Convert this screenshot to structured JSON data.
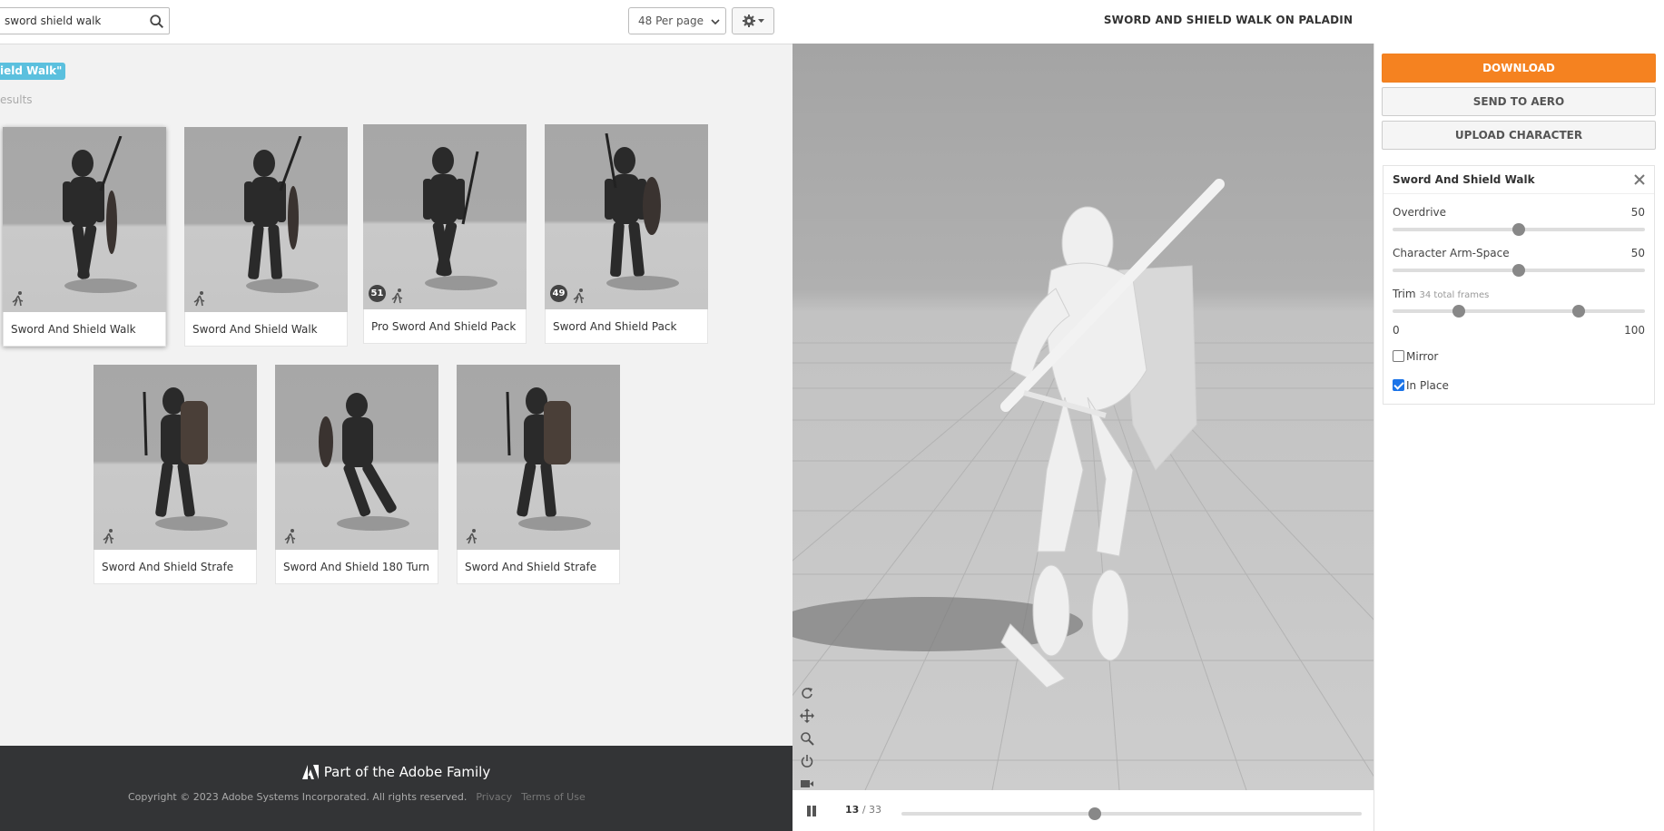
{
  "search": {
    "value": "sword shield walk"
  },
  "per_page": {
    "selected": "48 Per page"
  },
  "filter_tag": "ield Walk\"",
  "results_text": "esults",
  "cards": [
    {
      "label": "Sword And Shield Walk",
      "badge": "",
      "selected": true
    },
    {
      "label": "Sword And Shield Walk",
      "badge": ""
    },
    {
      "label": "Pro Sword And Shield Pack",
      "badge": "51"
    },
    {
      "label": "Sword And Shield Pack",
      "badge": "49"
    },
    {
      "label": "Sword And Shield Strafe",
      "badge": ""
    },
    {
      "label": "Sword And Shield 180 Turn",
      "badge": ""
    },
    {
      "label": "Sword And Shield Strafe",
      "badge": ""
    }
  ],
  "footer": {
    "brand": "Part of the Adobe Family",
    "copyright": "Copyright © 2023 Adobe Systems Incorporated. All rights reserved.",
    "privacy": "Privacy",
    "terms": "Terms of Use"
  },
  "viewer": {
    "title": "SWORD AND SHIELD WALK ON PALADIN",
    "frame_current": "13",
    "frame_total": "/ 33",
    "timeline_progress": 0.42
  },
  "panel": {
    "download": "DOWNLOAD",
    "send_to_aero": "SEND TO AERO",
    "upload_character": "UPLOAD CHARACTER",
    "anim_name": "Sword And Shield Walk",
    "overdrive_label": "Overdrive",
    "overdrive_value": "50",
    "arm_space_label": "Character Arm-Space",
    "arm_space_value": "50",
    "trim_label": "Trim",
    "trim_note": "34 total frames",
    "trim_min": "0",
    "trim_max": "100",
    "mirror_label": "Mirror",
    "mirror_checked": false,
    "in_place_label": "In Place",
    "in_place_checked": true
  },
  "colors": {
    "accent": "#f58220",
    "tag": "#5bc0de",
    "footer_bg": "#333436"
  }
}
